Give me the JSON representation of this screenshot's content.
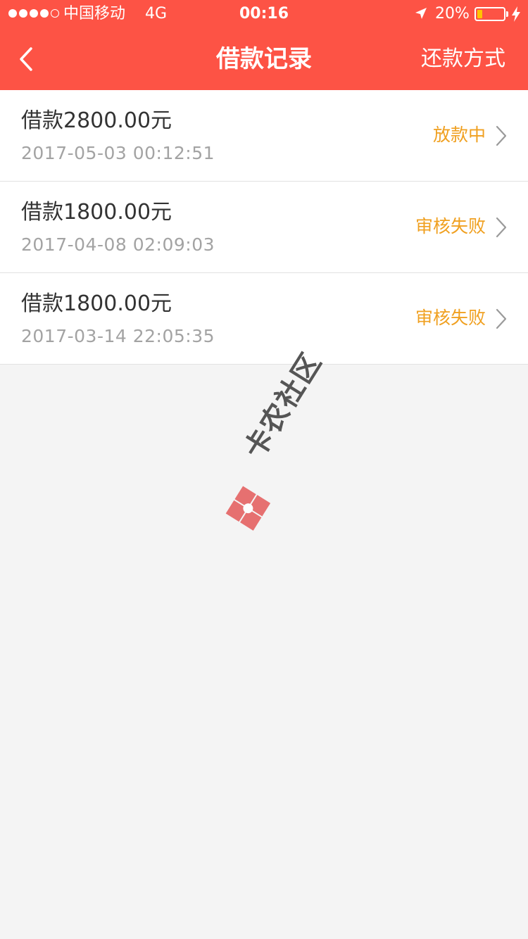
{
  "status_bar": {
    "carrier": "中国移动",
    "network": "4G",
    "time": "00:16",
    "battery_percent": "20%",
    "battery_level": 0.2,
    "signal_bars_filled": 4,
    "signal_bars_total": 5,
    "icons": [
      "signal-dots",
      "location-arrow-icon",
      "battery-icon",
      "charging-bolt-icon"
    ]
  },
  "nav": {
    "back_icon": "chevron-left-icon",
    "title": "借款记录",
    "right_action": "还款方式"
  },
  "records": [
    {
      "amount": "借款2800.00元",
      "time": "2017-05-03 00:12:51",
      "status": "放款中"
    },
    {
      "amount": "借款1800.00元",
      "time": "2017-04-08 02:09:03",
      "status": "审核失败"
    },
    {
      "amount": "借款1800.00元",
      "time": "2017-03-14 22:05:35",
      "status": "审核失败"
    }
  ],
  "watermark": {
    "text": "卡农社区"
  },
  "colors": {
    "header_bg": "#fd5345",
    "status_text": "#f0a020",
    "page_bg": "#f4f4f4",
    "amount_text": "#333333",
    "time_text": "#a3a3a3"
  }
}
